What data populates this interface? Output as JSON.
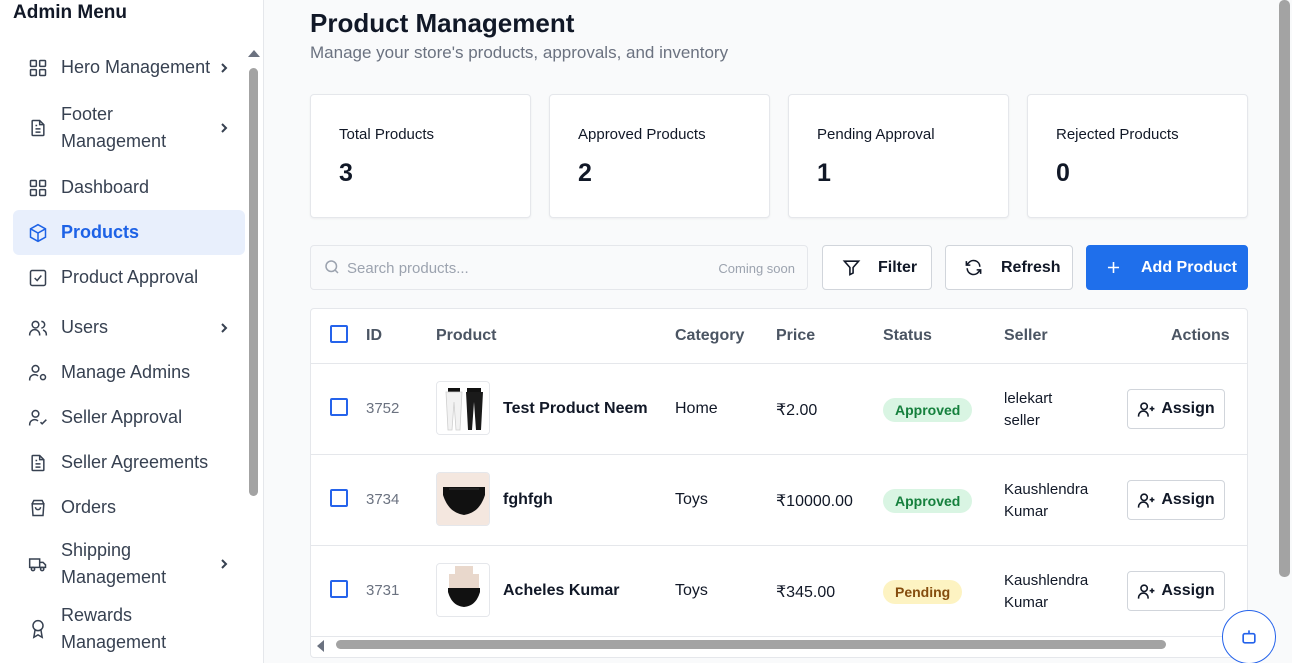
{
  "sidebar": {
    "title": "Admin Menu",
    "items": [
      {
        "label": "Hero Management",
        "icon": "grid-icon"
      },
      {
        "label": "Footer Management",
        "icon": "document-icon"
      },
      {
        "label": "Dashboard",
        "icon": "grid-icon"
      },
      {
        "label": "Products",
        "icon": "box-icon"
      },
      {
        "label": "Product Approval",
        "icon": "check-square-icon"
      },
      {
        "label": "Users",
        "icon": "users-icon"
      },
      {
        "label": "Manage Admins",
        "icon": "user-cog-icon"
      },
      {
        "label": "Seller Approval",
        "icon": "user-check-icon"
      },
      {
        "label": "Seller Agreements",
        "icon": "document-icon"
      },
      {
        "label": "Orders",
        "icon": "shopping-bag-icon"
      },
      {
        "label": "Shipping Management",
        "icon": "truck-icon"
      },
      {
        "label": "Rewards Management",
        "icon": "award-icon"
      }
    ]
  },
  "header": {
    "title": "Product Management",
    "subtitle": "Manage your store's products, approvals, and inventory"
  },
  "stats": [
    {
      "label": "Total Products",
      "value": "3"
    },
    {
      "label": "Approved Products",
      "value": "2"
    },
    {
      "label": "Pending Approval",
      "value": "1"
    },
    {
      "label": "Rejected Products",
      "value": "0"
    }
  ],
  "toolbar": {
    "search_placeholder": "Search products...",
    "search_note": "Coming soon",
    "filter_label": "Filter",
    "refresh_label": "Refresh",
    "add_label": "Add Product"
  },
  "table": {
    "headers": {
      "id": "ID",
      "product": "Product",
      "category": "Category",
      "price": "Price",
      "status": "Status",
      "seller": "Seller",
      "actions": "Actions"
    },
    "rows": [
      {
        "id": "3752",
        "name": "Test Product Neem",
        "category": "Home",
        "price": "₹2.00",
        "status": "Approved",
        "seller_line1": "lelekart",
        "seller_line2": "seller",
        "action": "Assign"
      },
      {
        "id": "3734",
        "name": "fghfgh",
        "category": "Toys",
        "price": "₹10000.00",
        "status": "Approved",
        "seller_line1": "Kaushlendra",
        "seller_line2": "Kumar",
        "action": "Assign"
      },
      {
        "id": "3731",
        "name": "Acheles Kumar",
        "category": "Toys",
        "price": "₹345.00",
        "status": "Pending",
        "seller_line1": "Kaushlendra",
        "seller_line2": "Kumar",
        "action": "Assign"
      }
    ]
  },
  "colors": {
    "accent": "#1f6feb",
    "active_bg": "#e8effc",
    "approved_bg": "#d9f5e3",
    "pending_bg": "#fdf3c2"
  }
}
